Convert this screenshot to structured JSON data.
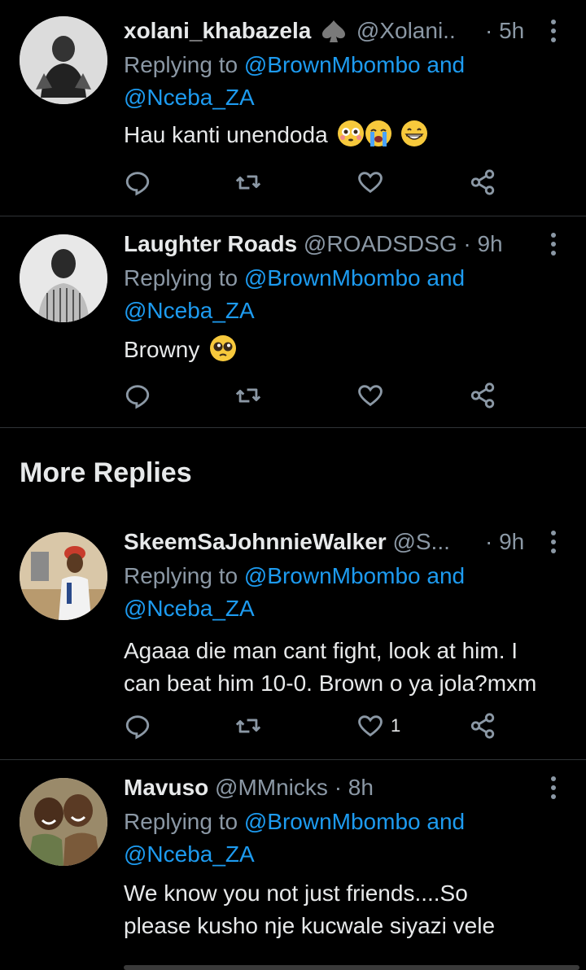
{
  "tweets": [
    {
      "name": "xolani_khabazela",
      "badge": "spade",
      "handle": "@Xolani...",
      "time": "· 5h",
      "replying_prefix": "Replying to ",
      "mention1": "@BrownMbombo",
      "and_word": " and",
      "mention2": "@Nceba_ZA",
      "text_lines": [
        "Hau kanti unendoda"
      ],
      "emojis": [
        "flushed-face",
        "loudly-crying-face",
        "grinning-face"
      ],
      "likes": ""
    },
    {
      "name": "Laughter Roads",
      "handle": "@ROADSDSG",
      "time": "· 9h",
      "replying_prefix": "Replying to ",
      "mention1": "@BrownMbombo",
      "and_word": " and",
      "mention2": "@Nceba_ZA",
      "text_lines": [
        "Browny"
      ],
      "emojis": [
        "pleading-face"
      ],
      "likes": ""
    },
    {
      "name": "SkeemSaJohnnieWalker",
      "handle": "@S...",
      "time": "· 9h",
      "replying_prefix": "Replying to ",
      "mention1": "@BrownMbombo",
      "and_word": " and",
      "mention2": "@Nceba_ZA",
      "text_lines": [
        "Agaaa die man cant fight, look at him. I",
        "can beat him 10-0. Brown o ya jola?mxm"
      ],
      "likes": "1"
    },
    {
      "name": "Mavuso",
      "handle": "@MMnicks",
      "time": "· 8h",
      "replying_prefix": "Replying to ",
      "mention1": "@BrownMbombo",
      "and_word": " and",
      "mention2": "@Nceba_ZA",
      "text_lines": [
        "We know you not just friends....So",
        "please kusho nje kucwale siyazi vele"
      ]
    }
  ],
  "section": {
    "more_replies": "More Replies"
  },
  "icons": {
    "reply": "reply-icon",
    "retweet": "retweet-icon",
    "like": "like-icon",
    "share": "share-icon",
    "more": "more-vertical-icon"
  },
  "colors": {
    "background": "#000000",
    "text": "#e7e9ea",
    "muted": "#8b98a5",
    "link": "#1d9bf0",
    "divider": "#2f3336"
  }
}
